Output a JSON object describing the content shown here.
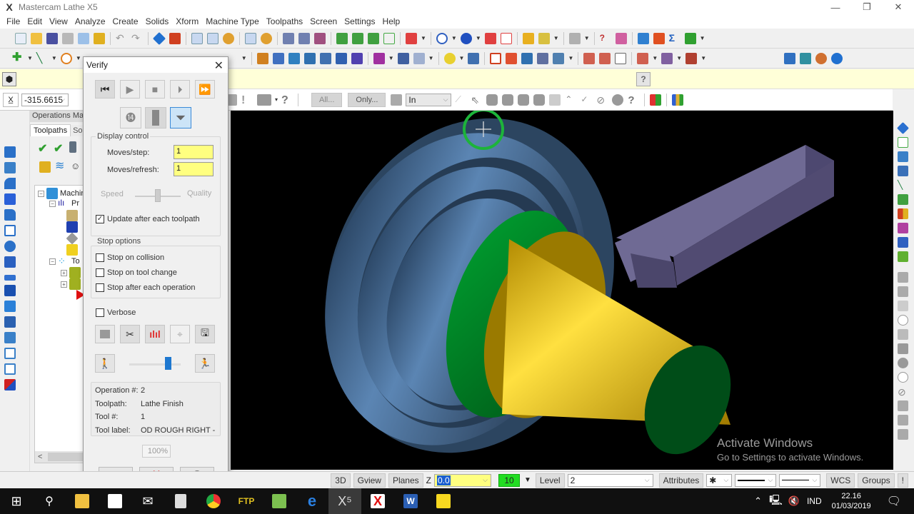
{
  "window": {
    "title": "Mastercam Lathe X5",
    "logo_icon": "mastercam-x-logo-icon",
    "controls": {
      "minimize": "—",
      "restore": "❐",
      "close": "✕"
    }
  },
  "menu": [
    "File",
    "Edit",
    "View",
    "Analyze",
    "Create",
    "Solids",
    "Xform",
    "Machine Type",
    "Toolpaths",
    "Screen",
    "Settings",
    "Help"
  ],
  "toolbar3": {
    "coord_value": "-315.6615",
    "all_label": "All...",
    "only_label": "Only...",
    "units_select": "In"
  },
  "ops_manager": {
    "title": "Operations Man",
    "tabs": [
      "Toolpaths",
      "So"
    ],
    "tree": [
      {
        "label": "Machin",
        "level": 0
      },
      {
        "label": "Pr",
        "level": 1
      },
      {
        "label": "To",
        "level": 1
      }
    ],
    "scroll_left": "<"
  },
  "verify": {
    "title": "Verify",
    "close": "✕",
    "playback": [
      "rewind",
      "play",
      "stop",
      "step",
      "fast-forward"
    ],
    "display_control": {
      "title": "Display control",
      "moves_step_label": "Moves/step:",
      "moves_step_value": "1",
      "moves_refresh_label": "Moves/refresh:",
      "moves_refresh_value": "1",
      "speed_label": "Speed",
      "quality_label": "Quality",
      "speed_quality_fraction": 0.5,
      "update_label": "Update after each toolpath",
      "update_checked": true
    },
    "stop_options": {
      "title": "Stop options",
      "items": [
        {
          "label": "Stop on collision",
          "checked": false
        },
        {
          "label": "Stop on tool change",
          "checked": false
        },
        {
          "label": "Stop after each operation",
          "checked": false
        }
      ]
    },
    "verbose": {
      "label": "Verbose",
      "checked": false
    },
    "sim_speed_fraction": 0.75,
    "info": {
      "operation_label": "Operation #:",
      "operation_value": "2",
      "toolpath_label": "Toolpath:",
      "toolpath_value": "Lathe Finish",
      "tool_label": "Tool #:",
      "tool_value": "1",
      "toollabel_label": "Tool label:",
      "toollabel_value": "OD ROUGH RIGHT -"
    },
    "progress": "100%",
    "buttons": {
      "ok": "✔",
      "cancel": "✖",
      "help": "?"
    }
  },
  "statusbar": {
    "view_3d": "3D",
    "gview": "Gview",
    "planes": "Planes",
    "z_label": "Z",
    "z_value": "0.0",
    "color_value": "10",
    "level_label": "Level",
    "level_value": "2",
    "attributes": "Attributes",
    "wcs": "WCS",
    "groups": "Groups",
    "bang": "!"
  },
  "watermark": {
    "title": "Activate Windows",
    "subtitle": "Go to Settings to activate Windows."
  },
  "taskbar": {
    "apps": [
      "start",
      "search",
      "file-explorer",
      "store",
      "mail",
      "calculator",
      "chrome",
      "filezilla",
      "coreldraw",
      "edge",
      "mastercam",
      "xmind",
      "word",
      "sticky-notes"
    ],
    "lang": "IND",
    "time": "22.16",
    "date": "01/03/2019"
  },
  "colors": {
    "prompt_bg": "#ffffd8",
    "input_yellow": "#ffff80",
    "stock_blue": "#4a6f96",
    "part_green": "#0a8a2a",
    "part_yellow": "#e6b800",
    "tool_purple": "#6f6a94",
    "status_green": "#22dd22"
  }
}
